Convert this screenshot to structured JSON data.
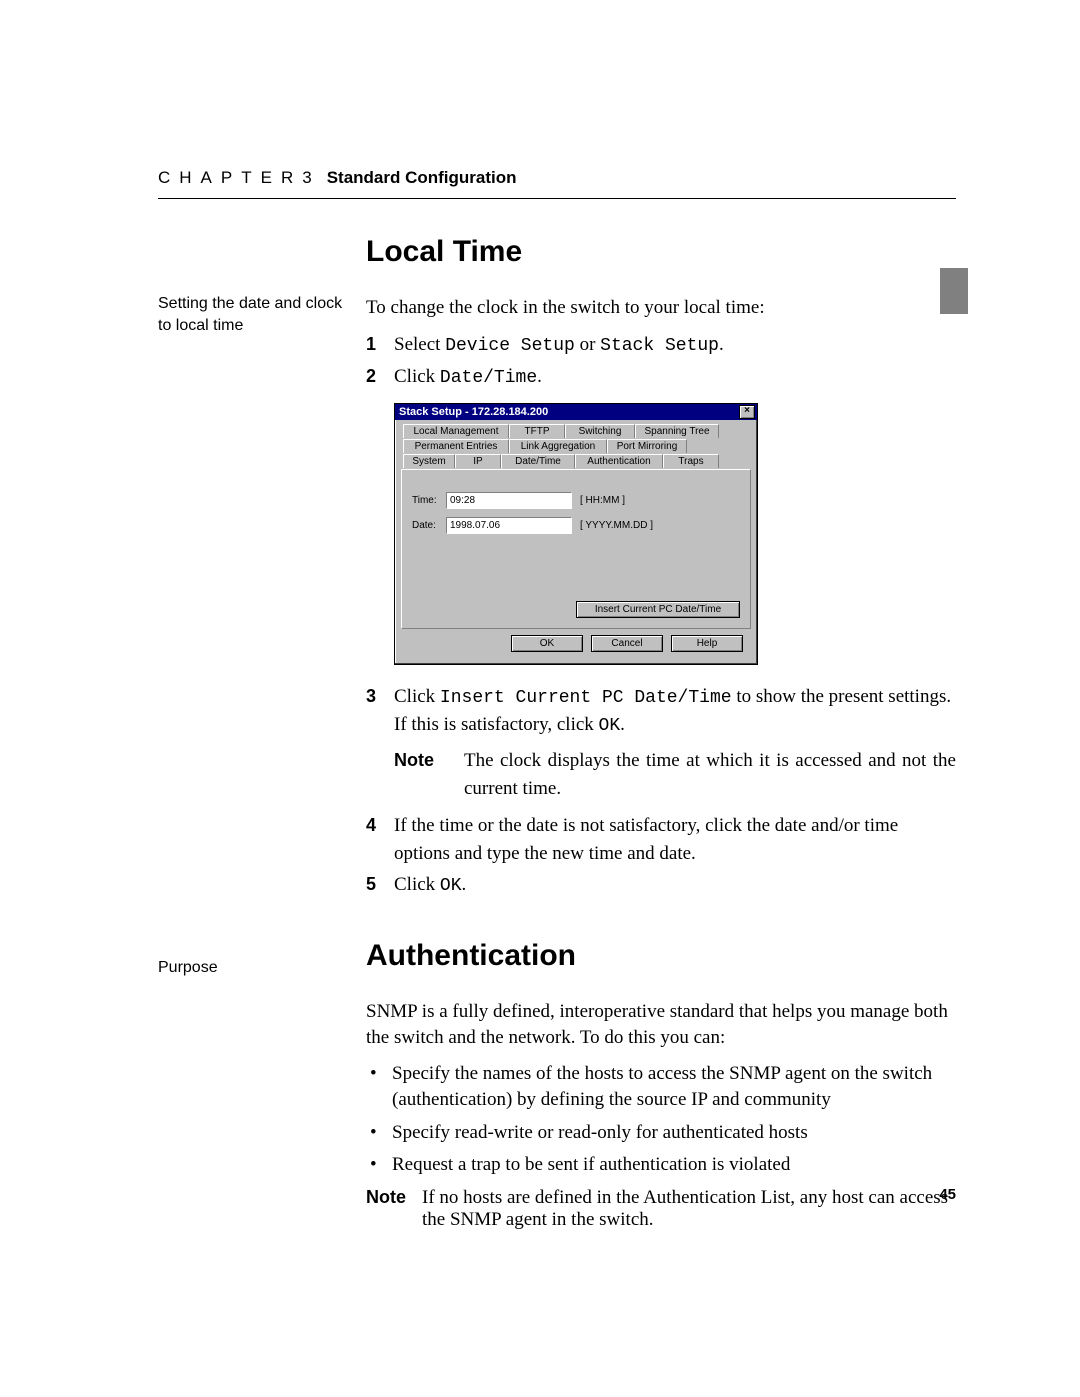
{
  "header": {
    "chapter": "CHAPTER3",
    "title": "Standard Configuration"
  },
  "section1": {
    "heading": "Local Time",
    "sidenote": "Setting the date and clock to local time",
    "intro": "To change the clock in the switch to your local time:",
    "step1_a": "Select ",
    "step1_b": "Device Setup",
    "step1_c": " or ",
    "step1_d": "Stack Setup",
    "step1_e": ".",
    "step2_a": "Click ",
    "step2_b": "Date/Time",
    "step2_c": ".",
    "step3_a": "Click ",
    "step3_b": "Insert Current PC Date/Time",
    "step3_c": " to show the present settings. If this is satisfactory, click ",
    "step3_d": "OK",
    "step3_e": ".",
    "note_label": "Note",
    "note_body": "The clock displays the time at which it is accessed and not the current time.",
    "step4": "If the time or the date is not satisfactory, click the date and/or time options and type the new time and date.",
    "step5_a": "Click ",
    "step5_b": "OK",
    "step5_c": "."
  },
  "dialog": {
    "title": "Stack Setup - 172.28.184.200",
    "tabs_r1": [
      "Local Management",
      "TFTP",
      "Switching",
      "Spanning Tree"
    ],
    "tabs_r2": [
      "Permanent Entries",
      "Link Aggregation",
      "Port Mirroring"
    ],
    "tabs_r3": [
      "System",
      "IP",
      "Date/Time",
      "Authentication",
      "Traps"
    ],
    "time_label": "Time:",
    "time_value": "09:28",
    "time_hint": "[ HH:MM ]",
    "date_label": "Date:",
    "date_value": "1998.07.06",
    "date_hint": "[ YYYY.MM.DD ]",
    "insert_btn": "Insert Current PC Date/Time",
    "ok": "OK",
    "cancel": "Cancel",
    "help": "Help"
  },
  "section2": {
    "heading": "Authentication",
    "sidenote": "Purpose",
    "intro": "SNMP is a fully defined, interoperative standard that helps you manage both the switch and the network. To do this you can:",
    "bullets": [
      "Specify the names of the hosts to access the SNMP agent on the switch (authentication) by defining the source IP and community",
      "Specify read-write or read-only for authenticated hosts",
      "Request a trap to be sent if authentication is violated"
    ],
    "note_label": "Note",
    "note_body": "If no hosts are defined in the Authentication List, any host can access the SNMP agent in the switch."
  },
  "page_number": "45"
}
